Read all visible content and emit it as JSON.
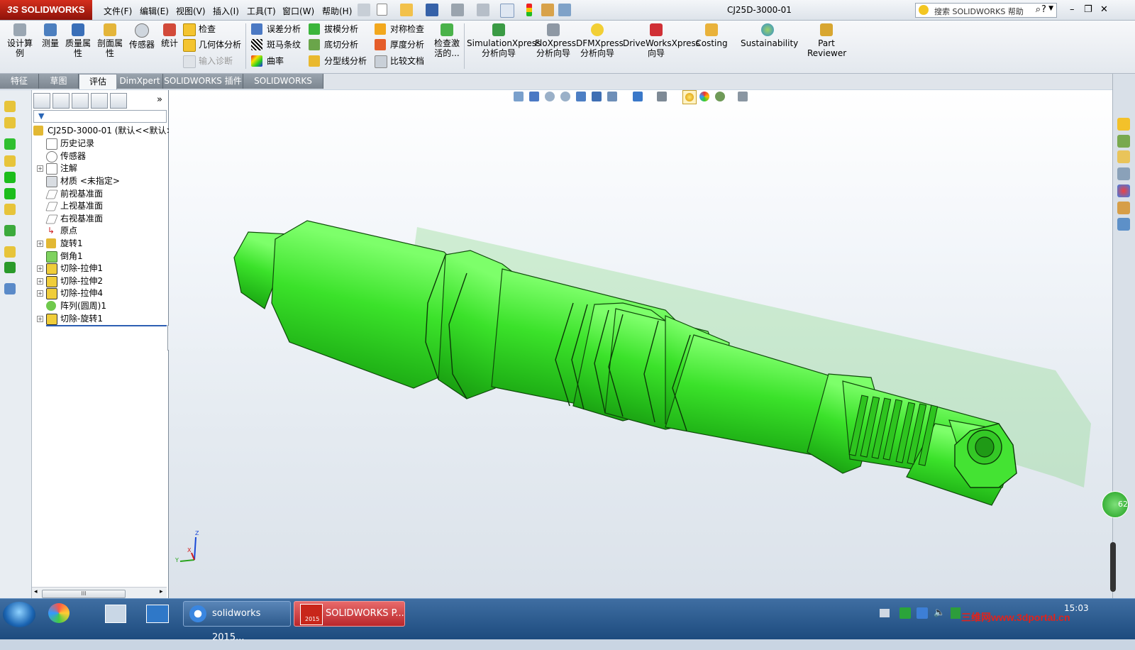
{
  "app": {
    "name": "SOLIDWORKS",
    "doc_title": "CJ25D-3000-01"
  },
  "menu": [
    "文件(F)",
    "编辑(E)",
    "视图(V)",
    "插入(I)",
    "工具(T)",
    "窗口(W)",
    "帮助(H)"
  ],
  "search": {
    "placeholder": "搜索 SOLIDWORKS 帮助"
  },
  "cmd": {
    "big": [
      {
        "label": "设计算\n例",
        "icon": "design-study-icon"
      },
      {
        "label": "测量",
        "icon": "measure-icon"
      },
      {
        "label": "质量属\n性",
        "icon": "mass-properties-icon"
      },
      {
        "label": "剖面属\n性",
        "icon": "section-properties-icon"
      },
      {
        "label": "传感器",
        "icon": "sensor-icon"
      },
      {
        "label": "统计",
        "icon": "statistics-icon"
      }
    ],
    "col1": [
      {
        "label": "检查"
      },
      {
        "label": "几何体分析"
      },
      {
        "label": "输入诊断"
      }
    ],
    "col2": [
      {
        "label": "误差分析"
      },
      {
        "label": "斑马条纹"
      },
      {
        "label": "曲率"
      }
    ],
    "col3": [
      {
        "label": "拔模分析"
      },
      {
        "label": "底切分析"
      },
      {
        "label": "分型线分析"
      }
    ],
    "col4": [
      {
        "label": "对称检查"
      },
      {
        "label": "厚度分析"
      },
      {
        "label": "比较文档"
      }
    ],
    "check_active": "检查激\n活的...",
    "xpress": [
      {
        "label": "SimulationXpress\n分析向导"
      },
      {
        "label": "FloXpress\n分析向导"
      },
      {
        "label": "DFMXpress\n分析向导"
      },
      {
        "label": "DriveWorksXpress\n向导"
      },
      {
        "label": "Costing"
      },
      {
        "label": "Sustainability"
      },
      {
        "label": "Part\nReviewer"
      }
    ]
  },
  "tabs": [
    "特征",
    "草图",
    "评估",
    "DimXpert",
    "SOLIDWORKS 插件",
    "SOLIDWORKS MBD"
  ],
  "active_tab": "评估",
  "tree": {
    "root": "CJ25D-3000-01  (默认<<默认>",
    "items": [
      "历史记录",
      "传感器",
      "注解",
      "材质 <未指定>",
      "前视基准面",
      "上视基准面",
      "右视基准面",
      "原点",
      "旋转1",
      "倒角1",
      "切除-拉伸1",
      "切除-拉伸2",
      "切除-拉伸4",
      "阵列(圆周)1",
      "切除-旋转1"
    ]
  },
  "scroll_thumb": "III",
  "viewport": {
    "side_badge": "62"
  },
  "triad": {
    "z": "Z",
    "y": "Y",
    "x": "X"
  },
  "taskbar": {
    "tasks": [
      "solidworks 2015...",
      "SOLIDWORKS P..."
    ],
    "sw_icon_text": "2015",
    "clock": "15:03"
  },
  "watermark": "三维网www.3dportal.cn",
  "colors": {
    "part_green": "#35d329",
    "accent_red": "#c8261a"
  }
}
